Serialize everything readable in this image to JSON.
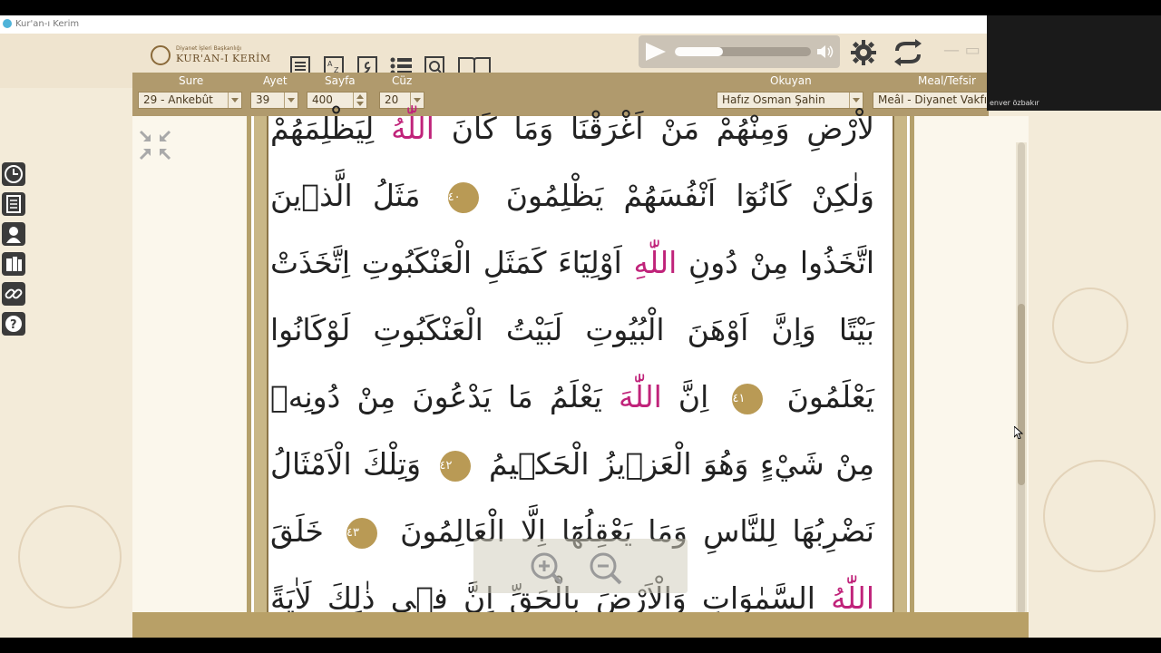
{
  "window": {
    "title": "Kur'an-ı Kerim"
  },
  "logo": {
    "line1": "Diyanet İşleri Başkanlığı",
    "line2": "KUR'AN-I KERİM"
  },
  "toolbar": {
    "icons": [
      "list-icon",
      "az-icon",
      "vav-icon",
      "bullet-list-icon",
      "tafsir-icon",
      "book-icon"
    ]
  },
  "audio": {
    "progress": 0.35
  },
  "controls": {
    "sure_label": "Sure",
    "sure_value": "29 - Ankebût",
    "ayet_label": "Ayet",
    "ayet_value": "39",
    "sayfa_label": "Sayfa",
    "sayfa_value": "400",
    "cuz_label": "Cüz",
    "cuz_value": "20",
    "okuyan_label": "Okuyan",
    "okuyan_value": "Hafız Osman Şahin",
    "meal_label": "Meal/Tefsir",
    "meal_value": "Meâl - Diyanet Vakfı"
  },
  "sidebar": [
    "clock-icon",
    "notes-icon",
    "person-icon",
    "books-icon",
    "link-icon",
    "help-icon"
  ],
  "quran": {
    "lines": [
      {
        "parts": [
          {
            "t": "ﻻْﺭْﺽِ ﻭَﻣِﻨْﻬُﻢْ ﻣَﻦْ ﺍَﻏْﺮَﻗْﻨَﺎ ﻭَﻣَﺎ ﻛَﺎﻥَ "
          },
          {
            "t": "ﺍﻟﻠّٰﻪُ",
            "a": true
          },
          {
            "t": " ﻟِﻴَﻈْﻠِﻤَﻬُﻢْ"
          }
        ]
      },
      {
        "parts": [
          {
            "t": "ﻭَﻟٰﻜِﻦْ ﻛَﺎﻧُﻮٓﺍ ﺍَﻧْﻔُﺴَﻬُﻢْ ﻳَﻈْﻠِﻤُﻮﻥَ "
          },
          {
            "m": "٤٠"
          },
          {
            "t": " ﻣَﺜَﻞُ ﺍﻟَّﺬٖﻳﻦَ"
          }
        ]
      },
      {
        "parts": [
          {
            "t": "ﺍﺗَّﺨَﺬُﻭﺍ ﻣِﻦْ ﺩُﻭﻥِ "
          },
          {
            "t": "ﺍﻟﻠّٰﻪِ",
            "a": true
          },
          {
            "t": " ﺍَﻭْﻟِﻴَٓﺎءَ ﻛَﻤَﺜَﻞِ ﺍﻟْﻌَﻨْﻜَﺒُﻮﺕِ ﺍِﺗَّﺨَﺬَﺕْ"
          }
        ]
      },
      {
        "parts": [
          {
            "t": "ﺑَﻴْﺘًﺎ ﻭَﺍِﻥَّ ﺍَﻭْﻫَﻦَ ﺍﻟْﺒُﻴُﻮﺕِ ﻟَﺒَﻴْﺖُ ﺍﻟْﻌَﻨْﻜَﺒُﻮﺕِ ﻟَﻮْﻛَﺎﻧُﻮﺍ"
          }
        ]
      },
      {
        "parts": [
          {
            "t": "ﻳَﻌْﻠَﻤُﻮﻥَ "
          },
          {
            "m": "٤١"
          },
          {
            "t": " ﺍِﻥَّ "
          },
          {
            "t": "ﺍﻟﻠّٰﻪَ",
            "a": true
          },
          {
            "t": " ﻳَﻌْﻠَﻢُ ﻣَﺎ ﻳَﺪْﻋُﻮﻥَ ﻣِﻦْ ﺩُﻭﻧِﻪٖ"
          }
        ]
      },
      {
        "parts": [
          {
            "t": "ﻣِﻦْ ﺷَﻲْءٍ ﻭَﻫُﻮَ ﺍﻟْﻌَﺰٖﻳﺰُ ﺍﻟْﺤَﻜٖﻴﻢُ "
          },
          {
            "m": "٤٢"
          },
          {
            "t": " ﻭَﺗِﻠْﻚَ ﺍﻟْﺎَﻣْﺜَﺎﻝُ"
          }
        ]
      },
      {
        "parts": [
          {
            "t": "ﻧَﻀْﺮِﺑُﻬَﺎ ﻟِﻠﻨَّﺎﺱِ ﻭَﻣَﺎ ﻳَﻌْﻘِﻠُﻬَٓﺎ ﺍِﻟَّﺎ ﺍﻟْﻌَﺎﻟِﻤُﻮﻥَ "
          },
          {
            "m": "٤٣"
          },
          {
            "t": " ﺧَﻠَﻖَ"
          }
        ]
      },
      {
        "parts": [
          {
            "t": "ﺍﻟﻠّٰﻪُ",
            "a": true
          },
          {
            "t": " ﺍﻟﺴَّﻤٰﻮَﺍﺕِ ﻭَﺍﻟْﺎَﺭْﺽَ ﺑِﺎﻟْﺤَﻖِّ ﺍِﻥَّ ﻓٖﻲ ﺫٰﻟِﻚَ ﻟَﺎٰﻳَﺔً"
          }
        ]
      }
    ]
  },
  "webcam": {
    "name": "enver özbakır"
  },
  "colors": {
    "accent": "#b09a6d",
    "allah": "#c0237a",
    "verse_marker": "#b99a55"
  }
}
